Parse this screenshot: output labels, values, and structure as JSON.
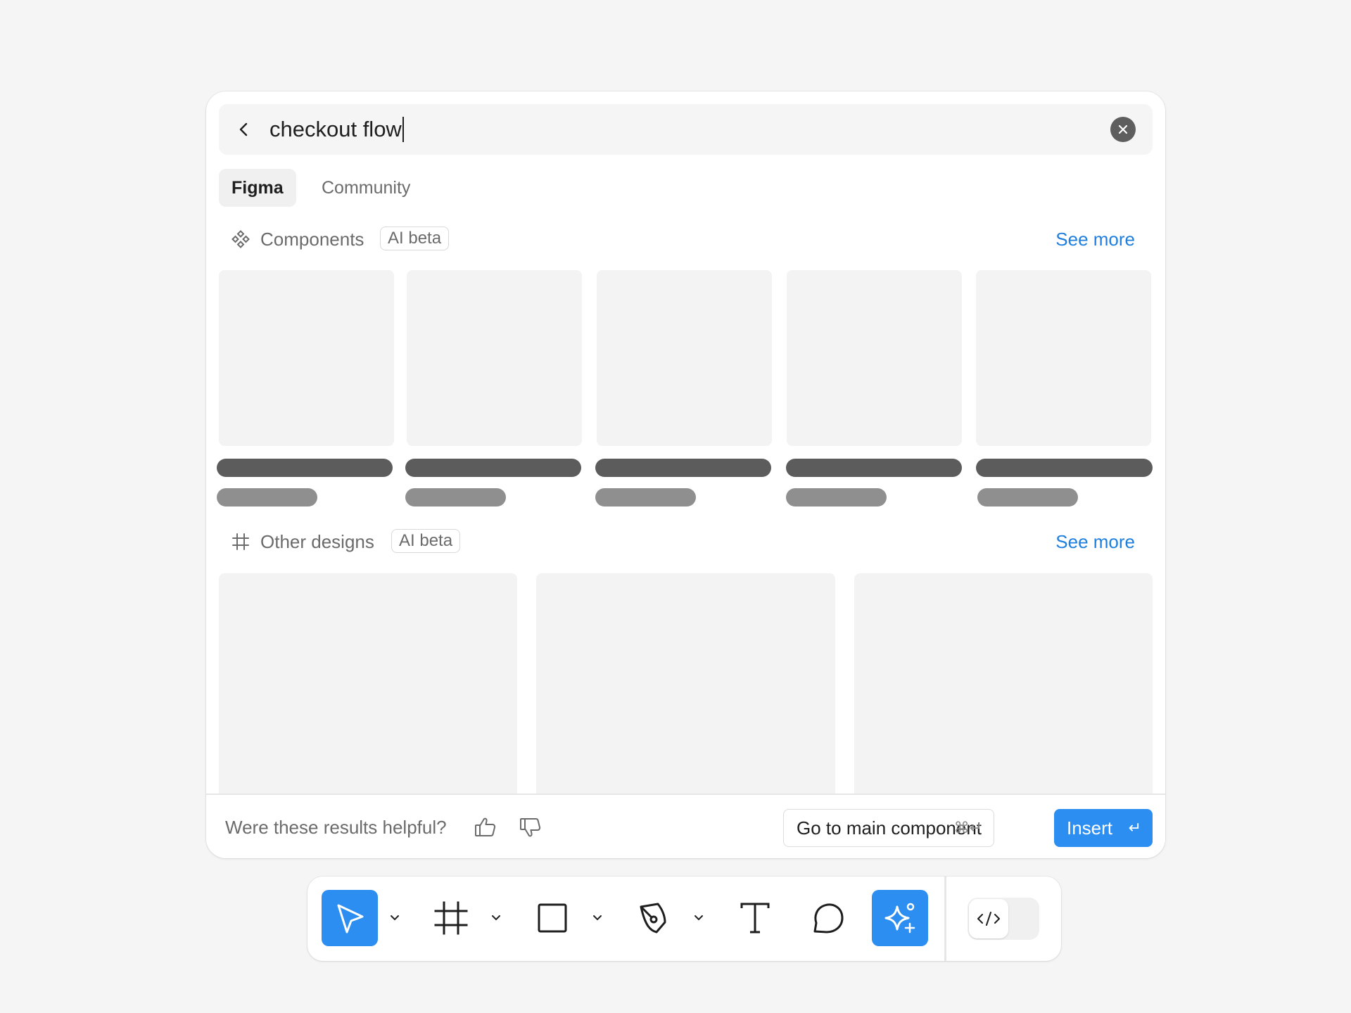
{
  "search": {
    "query": "checkout flow",
    "back_icon": "chevron-left-icon",
    "clear_icon": "close-circle-icon"
  },
  "tabs": [
    {
      "label": "Figma",
      "active": true
    },
    {
      "label": "Community",
      "active": false
    }
  ],
  "sections": [
    {
      "icon": "component-icon",
      "title": "Components",
      "badge": "AI beta",
      "see_more": "See more",
      "result_count": 5,
      "loading": true
    },
    {
      "icon": "frame-icon",
      "title": "Other designs",
      "badge": "AI beta",
      "see_more": "See more",
      "result_count": 3,
      "loading": true
    }
  ],
  "footer": {
    "question": "Were these results helpful?",
    "thumbs_up_icon": "thumbs-up-icon",
    "thumbs_down_icon": "thumbs-down-icon",
    "go_to_main_label": "Go to main component",
    "go_to_main_shortcut": "⌘↵",
    "insert_label": "Insert",
    "insert_shortcut": "↵"
  },
  "toolbar": {
    "tools": [
      {
        "name": "move",
        "icon": "cursor-icon",
        "active": true,
        "has_menu": true
      },
      {
        "name": "frame",
        "icon": "frame-icon",
        "active": false,
        "has_menu": true
      },
      {
        "name": "shape",
        "icon": "rectangle-icon",
        "active": false,
        "has_menu": true
      },
      {
        "name": "pen",
        "icon": "pen-icon",
        "active": false,
        "has_menu": true
      },
      {
        "name": "text",
        "icon": "text-icon",
        "active": false,
        "has_menu": false
      },
      {
        "name": "comment",
        "icon": "comment-icon",
        "active": false,
        "has_menu": false
      },
      {
        "name": "actions",
        "icon": "ai-sparkle-icon",
        "active": true,
        "has_menu": false
      }
    ],
    "dev_mode_icon": "code-icon",
    "dev_mode_on": false
  },
  "colors": {
    "accent": "#2c8ef0",
    "link": "#1e7fde",
    "background": "#f5f5f5",
    "panel": "#ffffff",
    "skeleton_dark": "#5c5c5c",
    "skeleton_light": "#8f8f8f",
    "thumbnail": "#f3f3f3"
  }
}
